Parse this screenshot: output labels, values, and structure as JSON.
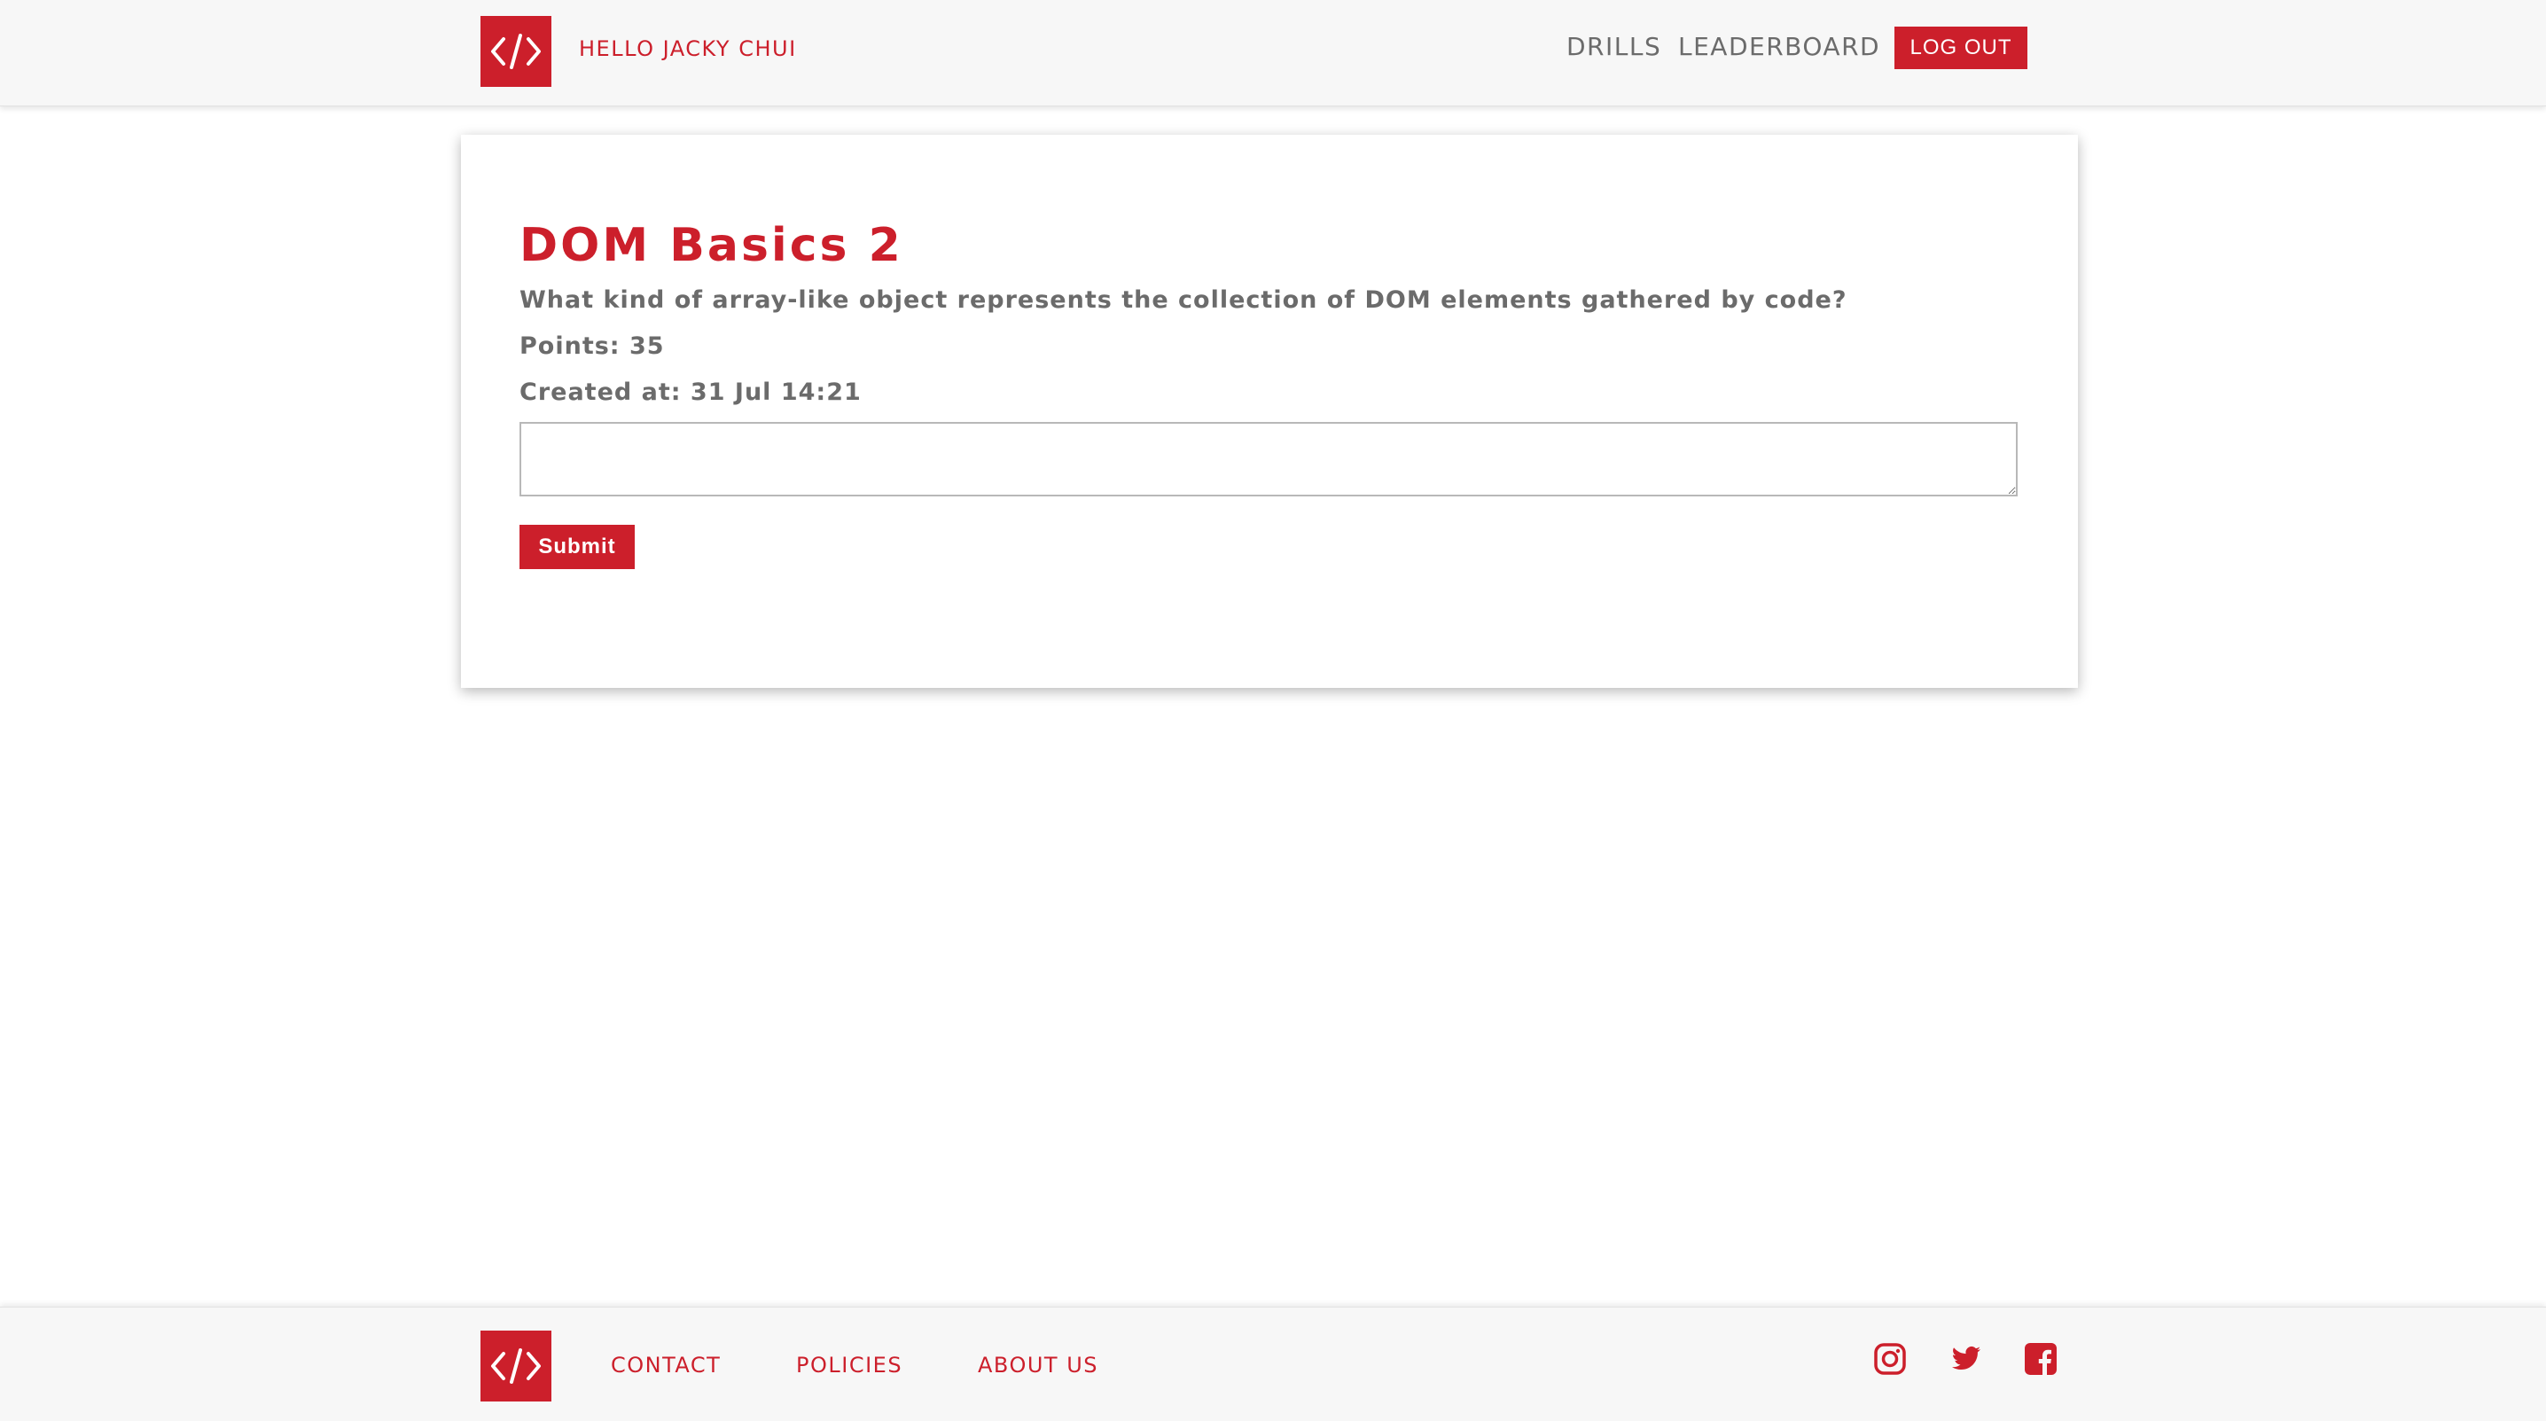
{
  "header": {
    "greeting": "HELLO JACKY CHUI",
    "nav": {
      "drills": "DRILLS",
      "leaderboard": "LEADERBOARD"
    },
    "logout_label": "LOG OUT"
  },
  "drill": {
    "title": "DOM Basics 2",
    "question": "What kind of array-like object represents the collection of DOM elements gathered by code?",
    "points": "Points: 35",
    "created": "Created at: 31 Jul 14:21",
    "answer_value": "",
    "submit_label": "Submit"
  },
  "footer": {
    "links": [
      "CONTACT",
      "POLICIES",
      "ABOUT US"
    ],
    "social_icons": [
      "instagram-icon",
      "twitter-icon",
      "facebook-icon"
    ]
  },
  "icons": {
    "logo": "code-brackets-icon"
  },
  "colors": {
    "brand": "#cc1f2b",
    "text_muted": "#6b6b6b",
    "bar_bg": "#f7f7f7"
  }
}
